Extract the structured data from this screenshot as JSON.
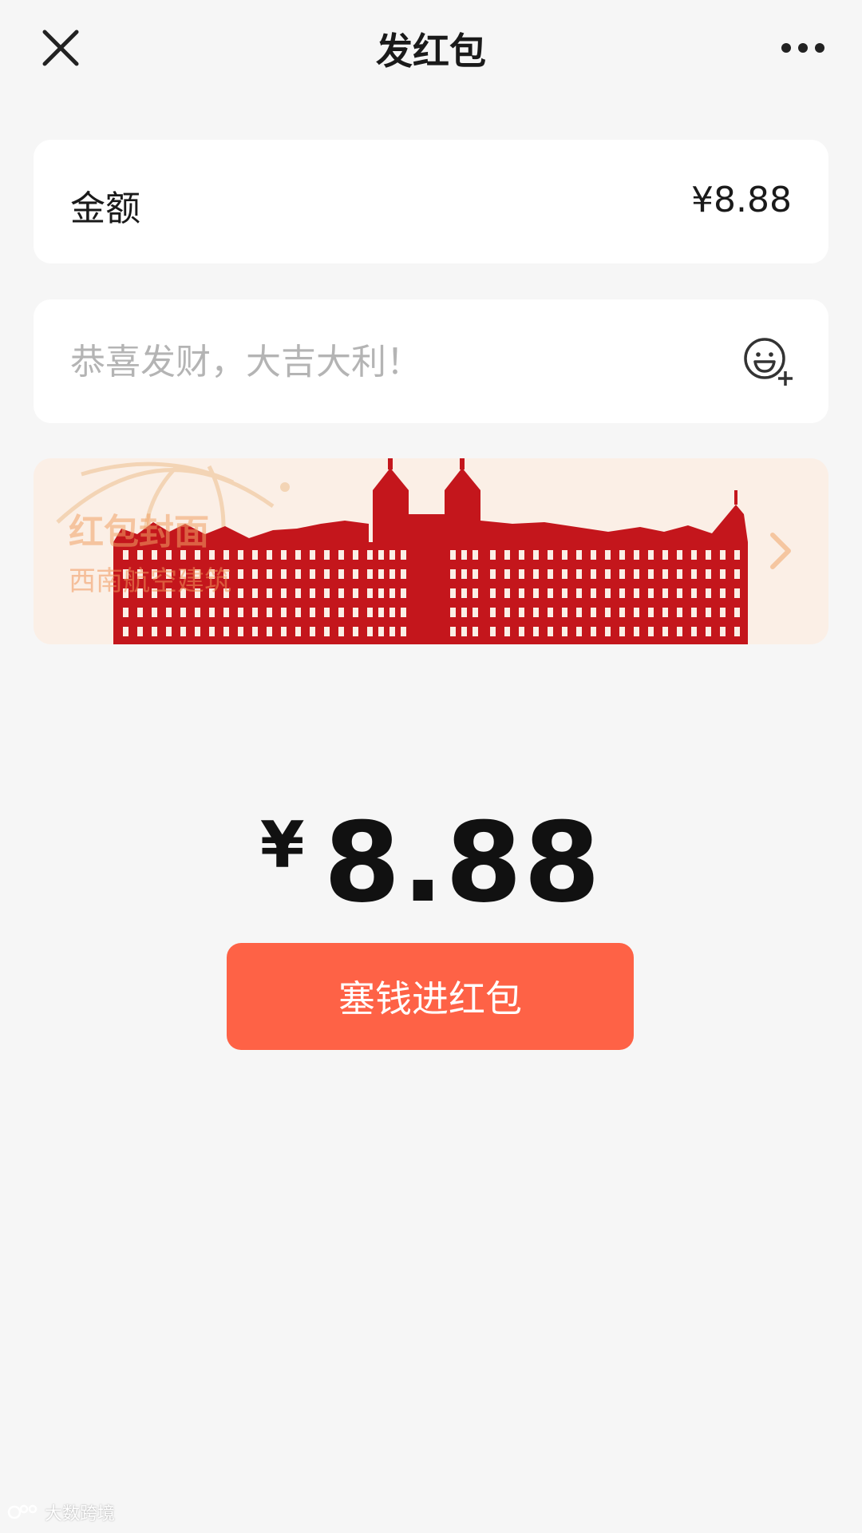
{
  "header": {
    "title": "发红包"
  },
  "amount": {
    "label": "金额",
    "value": "¥8.88"
  },
  "message": {
    "placeholder": "恭喜发财，大吉大利！",
    "value": ""
  },
  "cover": {
    "title": "红包封面",
    "subtitle": "西南航空建筑"
  },
  "summary": {
    "currency": "¥",
    "amount": "8.88"
  },
  "actions": {
    "send_label": "塞钱进红包"
  },
  "watermark": {
    "text": "大数跨境"
  },
  "colors": {
    "accent": "#fe6246",
    "background": "#f6f6f6",
    "cover_bg": "#fbefe6",
    "cover_art": "#c4161c"
  },
  "icons": [
    "close-icon",
    "more-icon",
    "emoji-add-icon",
    "chevron-right-icon"
  ]
}
